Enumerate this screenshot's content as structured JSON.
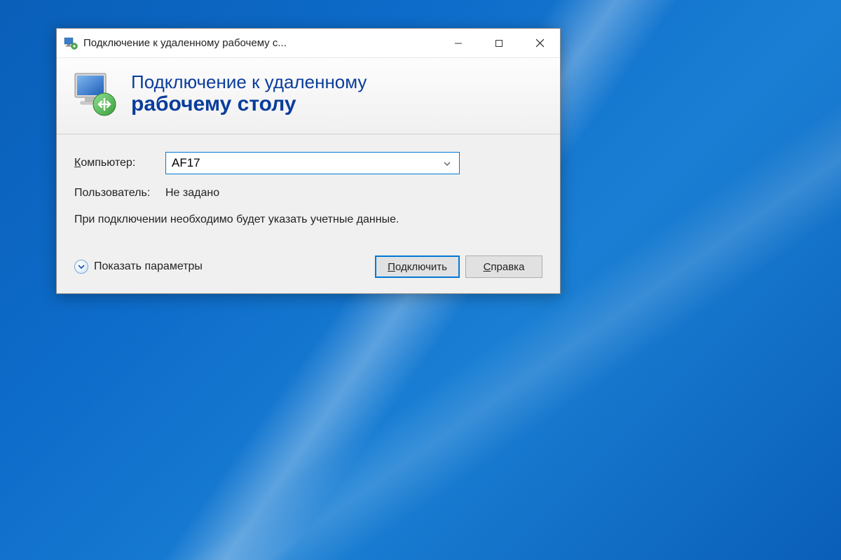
{
  "window": {
    "title": "Подключение к удаленному рабочему с..."
  },
  "header": {
    "line1": "Подключение к удаленному",
    "line2": "рабочему столу"
  },
  "form": {
    "computer_label": "Компьютер:",
    "computer_value": "AF17",
    "user_label": "Пользователь:",
    "user_value": "Не задано",
    "info_text": "При подключении необходимо будет указать учетные данные."
  },
  "footer": {
    "show_options": "Показать параметры",
    "connect": "Подключить",
    "help": "Справка"
  }
}
